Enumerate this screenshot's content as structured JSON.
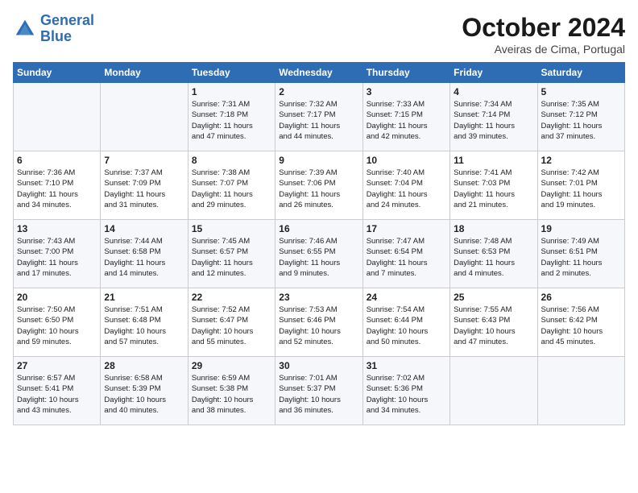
{
  "header": {
    "logo_line1": "General",
    "logo_line2": "Blue",
    "month": "October 2024",
    "location": "Aveiras de Cima, Portugal"
  },
  "weekdays": [
    "Sunday",
    "Monday",
    "Tuesday",
    "Wednesday",
    "Thursday",
    "Friday",
    "Saturday"
  ],
  "weeks": [
    [
      {
        "day": "",
        "info": ""
      },
      {
        "day": "",
        "info": ""
      },
      {
        "day": "1",
        "info": "Sunrise: 7:31 AM\nSunset: 7:18 PM\nDaylight: 11 hours\nand 47 minutes."
      },
      {
        "day": "2",
        "info": "Sunrise: 7:32 AM\nSunset: 7:17 PM\nDaylight: 11 hours\nand 44 minutes."
      },
      {
        "day": "3",
        "info": "Sunrise: 7:33 AM\nSunset: 7:15 PM\nDaylight: 11 hours\nand 42 minutes."
      },
      {
        "day": "4",
        "info": "Sunrise: 7:34 AM\nSunset: 7:14 PM\nDaylight: 11 hours\nand 39 minutes."
      },
      {
        "day": "5",
        "info": "Sunrise: 7:35 AM\nSunset: 7:12 PM\nDaylight: 11 hours\nand 37 minutes."
      }
    ],
    [
      {
        "day": "6",
        "info": "Sunrise: 7:36 AM\nSunset: 7:10 PM\nDaylight: 11 hours\nand 34 minutes."
      },
      {
        "day": "7",
        "info": "Sunrise: 7:37 AM\nSunset: 7:09 PM\nDaylight: 11 hours\nand 31 minutes."
      },
      {
        "day": "8",
        "info": "Sunrise: 7:38 AM\nSunset: 7:07 PM\nDaylight: 11 hours\nand 29 minutes."
      },
      {
        "day": "9",
        "info": "Sunrise: 7:39 AM\nSunset: 7:06 PM\nDaylight: 11 hours\nand 26 minutes."
      },
      {
        "day": "10",
        "info": "Sunrise: 7:40 AM\nSunset: 7:04 PM\nDaylight: 11 hours\nand 24 minutes."
      },
      {
        "day": "11",
        "info": "Sunrise: 7:41 AM\nSunset: 7:03 PM\nDaylight: 11 hours\nand 21 minutes."
      },
      {
        "day": "12",
        "info": "Sunrise: 7:42 AM\nSunset: 7:01 PM\nDaylight: 11 hours\nand 19 minutes."
      }
    ],
    [
      {
        "day": "13",
        "info": "Sunrise: 7:43 AM\nSunset: 7:00 PM\nDaylight: 11 hours\nand 17 minutes."
      },
      {
        "day": "14",
        "info": "Sunrise: 7:44 AM\nSunset: 6:58 PM\nDaylight: 11 hours\nand 14 minutes."
      },
      {
        "day": "15",
        "info": "Sunrise: 7:45 AM\nSunset: 6:57 PM\nDaylight: 11 hours\nand 12 minutes."
      },
      {
        "day": "16",
        "info": "Sunrise: 7:46 AM\nSunset: 6:55 PM\nDaylight: 11 hours\nand 9 minutes."
      },
      {
        "day": "17",
        "info": "Sunrise: 7:47 AM\nSunset: 6:54 PM\nDaylight: 11 hours\nand 7 minutes."
      },
      {
        "day": "18",
        "info": "Sunrise: 7:48 AM\nSunset: 6:53 PM\nDaylight: 11 hours\nand 4 minutes."
      },
      {
        "day": "19",
        "info": "Sunrise: 7:49 AM\nSunset: 6:51 PM\nDaylight: 11 hours\nand 2 minutes."
      }
    ],
    [
      {
        "day": "20",
        "info": "Sunrise: 7:50 AM\nSunset: 6:50 PM\nDaylight: 10 hours\nand 59 minutes."
      },
      {
        "day": "21",
        "info": "Sunrise: 7:51 AM\nSunset: 6:48 PM\nDaylight: 10 hours\nand 57 minutes."
      },
      {
        "day": "22",
        "info": "Sunrise: 7:52 AM\nSunset: 6:47 PM\nDaylight: 10 hours\nand 55 minutes."
      },
      {
        "day": "23",
        "info": "Sunrise: 7:53 AM\nSunset: 6:46 PM\nDaylight: 10 hours\nand 52 minutes."
      },
      {
        "day": "24",
        "info": "Sunrise: 7:54 AM\nSunset: 6:44 PM\nDaylight: 10 hours\nand 50 minutes."
      },
      {
        "day": "25",
        "info": "Sunrise: 7:55 AM\nSunset: 6:43 PM\nDaylight: 10 hours\nand 47 minutes."
      },
      {
        "day": "26",
        "info": "Sunrise: 7:56 AM\nSunset: 6:42 PM\nDaylight: 10 hours\nand 45 minutes."
      }
    ],
    [
      {
        "day": "27",
        "info": "Sunrise: 6:57 AM\nSunset: 5:41 PM\nDaylight: 10 hours\nand 43 minutes."
      },
      {
        "day": "28",
        "info": "Sunrise: 6:58 AM\nSunset: 5:39 PM\nDaylight: 10 hours\nand 40 minutes."
      },
      {
        "day": "29",
        "info": "Sunrise: 6:59 AM\nSunset: 5:38 PM\nDaylight: 10 hours\nand 38 minutes."
      },
      {
        "day": "30",
        "info": "Sunrise: 7:01 AM\nSunset: 5:37 PM\nDaylight: 10 hours\nand 36 minutes."
      },
      {
        "day": "31",
        "info": "Sunrise: 7:02 AM\nSunset: 5:36 PM\nDaylight: 10 hours\nand 34 minutes."
      },
      {
        "day": "",
        "info": ""
      },
      {
        "day": "",
        "info": ""
      }
    ]
  ]
}
